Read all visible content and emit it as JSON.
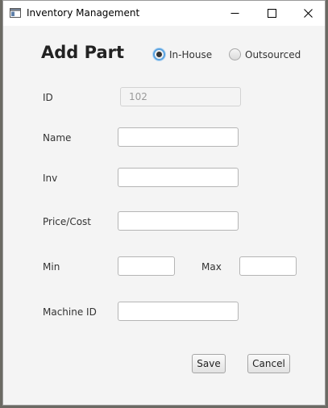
{
  "window": {
    "title": "Inventory Management"
  },
  "form": {
    "heading": "Add Part",
    "source_options": [
      {
        "label": "In-House",
        "selected": true
      },
      {
        "label": "Outsourced",
        "selected": false
      }
    ],
    "fields": {
      "id": {
        "label": "ID",
        "value": "102"
      },
      "name": {
        "label": "Name",
        "value": ""
      },
      "inv": {
        "label": "Inv",
        "value": ""
      },
      "price": {
        "label": "Price/Cost",
        "value": ""
      },
      "min": {
        "label": "Min",
        "value": ""
      },
      "max": {
        "label": "Max",
        "value": ""
      },
      "machine_id": {
        "label": "Machine ID",
        "value": ""
      }
    },
    "buttons": {
      "save": "Save",
      "cancel": "Cancel"
    }
  },
  "colors": {
    "accent": "#5aa3e0",
    "window_bg": "#f4f4f4",
    "titlebar_bg": "#ffffff"
  },
  "icons": [
    "app-window-icon",
    "minimize-icon",
    "maximize-icon",
    "close-icon"
  ]
}
